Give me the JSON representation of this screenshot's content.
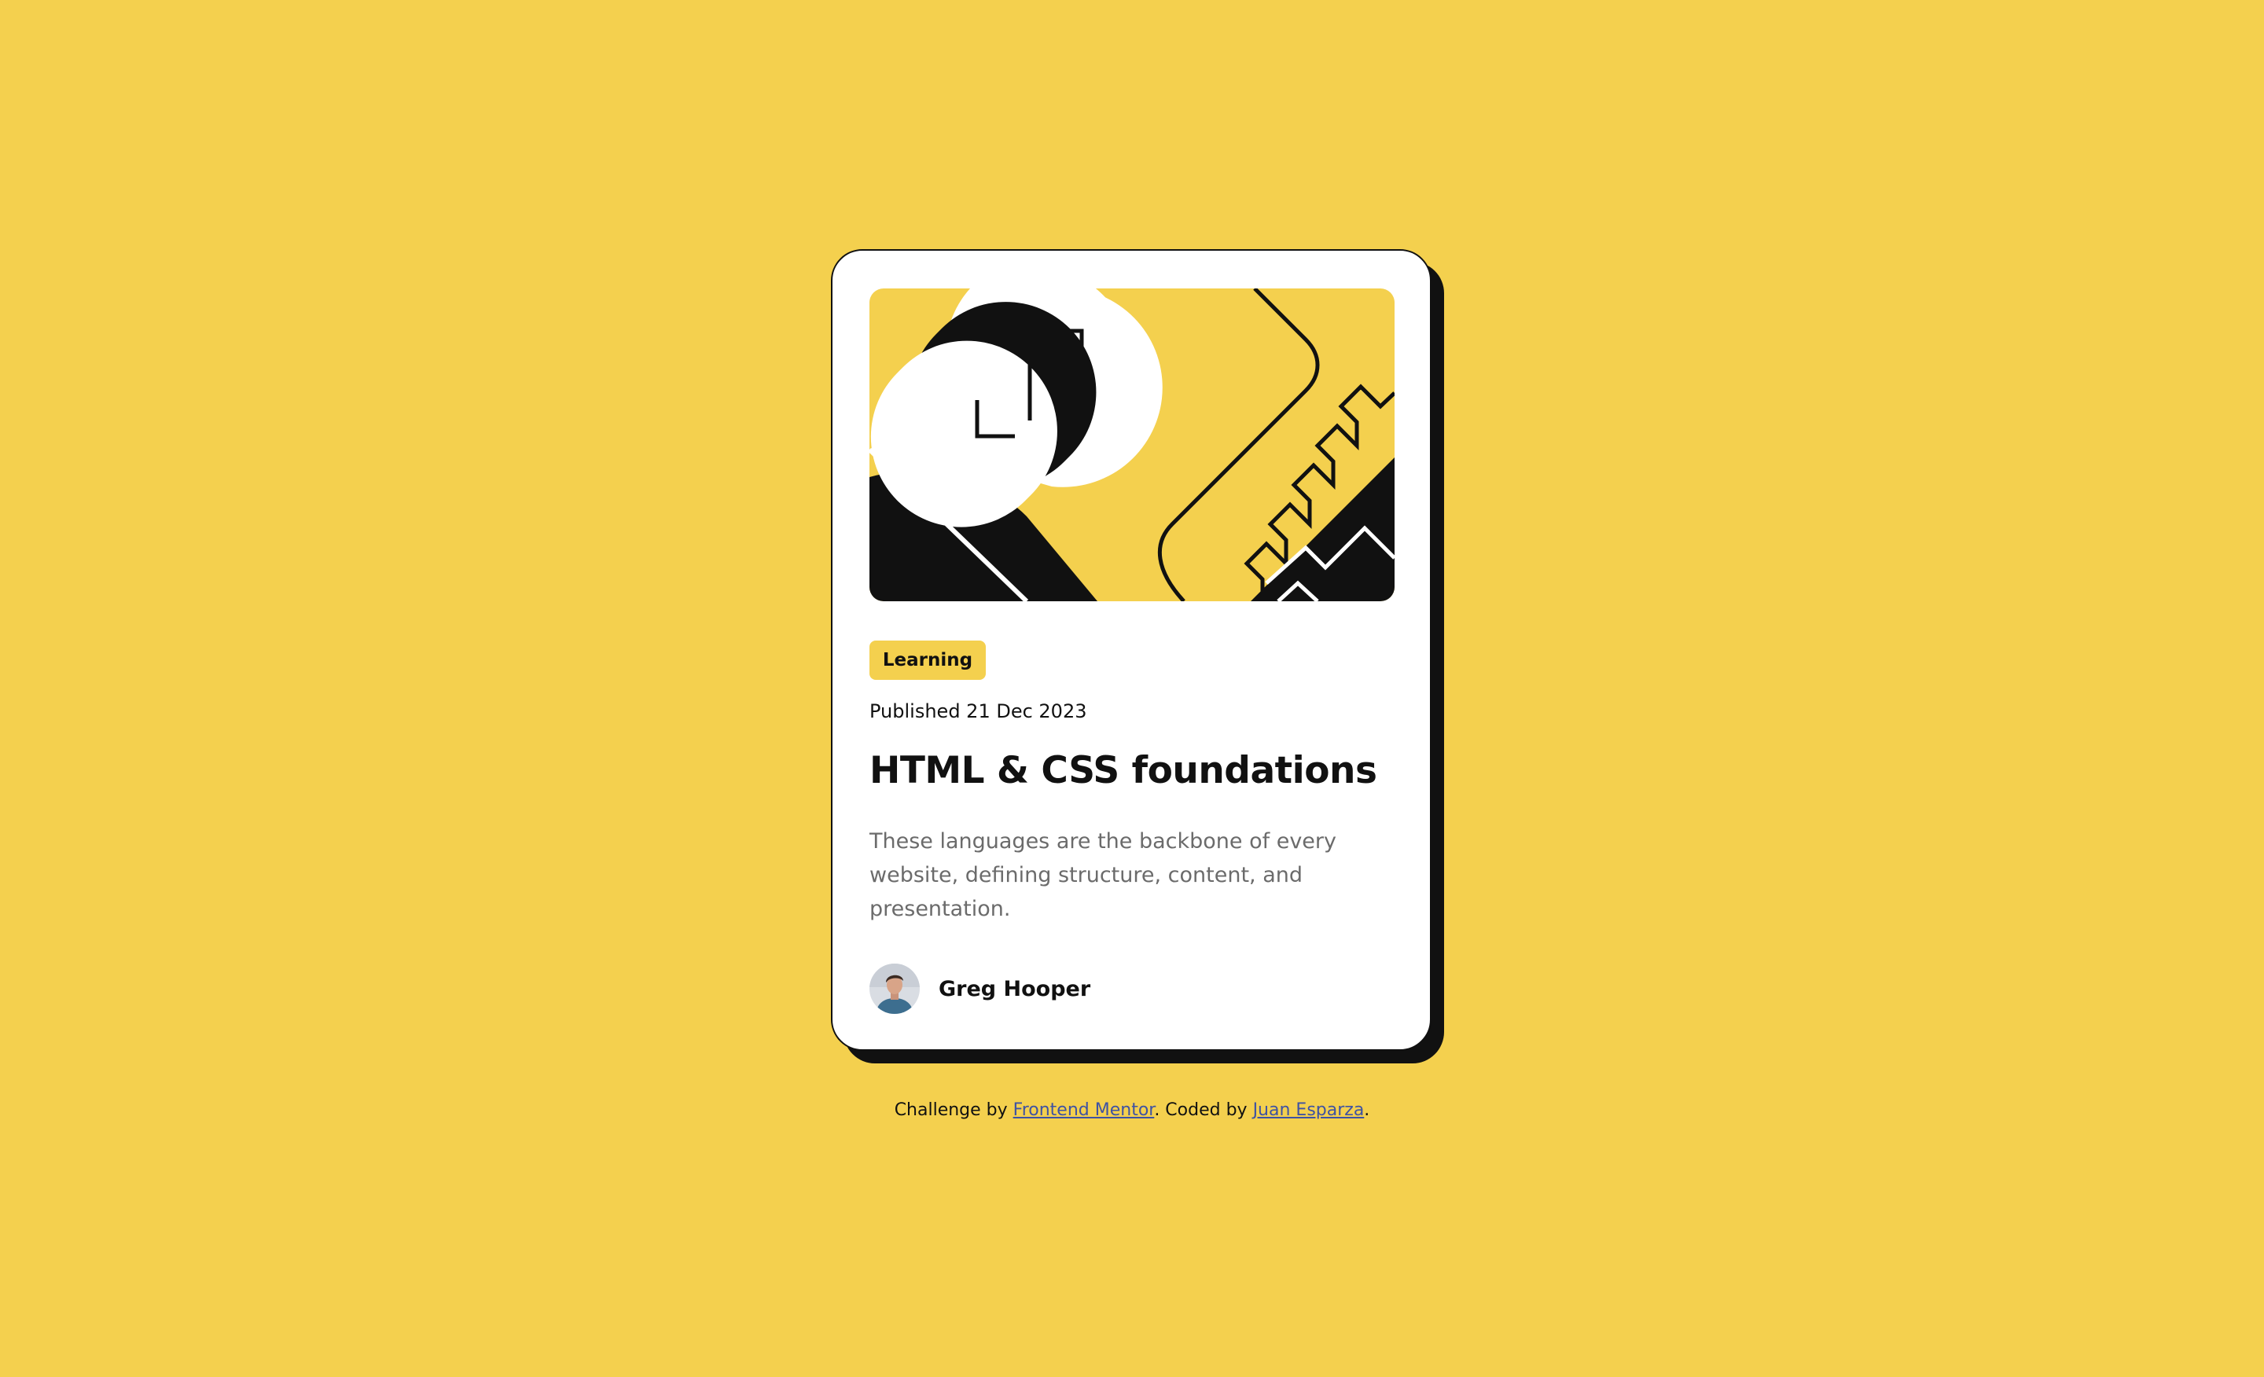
{
  "card": {
    "tag": "Learning",
    "published": "Published 21 Dec 2023",
    "title": "HTML & CSS foundations",
    "description": "These languages are the backbone of every website, defining structure, content, and presentation.",
    "author": "Greg Hooper"
  },
  "attribution": {
    "prefix": "Challenge by ",
    "link1": "Frontend Mentor",
    "middle": ". Coded by ",
    "link2": "Juan Esparza",
    "suffix": "."
  },
  "colors": {
    "background": "#F4D04E",
    "ink": "#111111",
    "muted": "#6B6B6B",
    "card": "#FFFFFF"
  },
  "icons": {
    "hero": "abstract-illustration",
    "avatar": "author-avatar-photo"
  }
}
